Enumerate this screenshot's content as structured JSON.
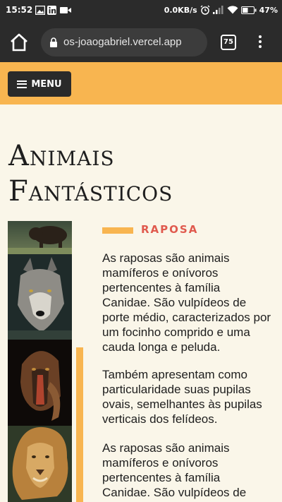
{
  "status_bar": {
    "time": "15:52",
    "network_speed": "0.0KB/s",
    "battery": "47%"
  },
  "browser": {
    "url": "os-joaogabriel.vercel.app",
    "tab_count": "75"
  },
  "header": {
    "menu_label": "MENU"
  },
  "page": {
    "title_line1": "Animais",
    "title_line2": "Fantásticos"
  },
  "section": {
    "title": "RAPOSA",
    "paragraphs": [
      "As raposas são animais mamíferos e onívoros pertencentes à família Canidae. São vulpídeos de porte médio, caracterizados por um focinho comprido e uma cauda longa e peluda.",
      "Também apresentam como particularidade suas pupilas ovais, semelhantes às pupilas verticais dos felídeos.",
      "As raposas são animais mamíferos e onívoros pertencentes à família Canidae. São vulpídeos de porte médio, caracterizados"
    ]
  },
  "colors": {
    "accent": "#F8B550",
    "section_title": "#E05A4E",
    "background": "#FAF6E9",
    "dark": "#2A2A2A"
  }
}
